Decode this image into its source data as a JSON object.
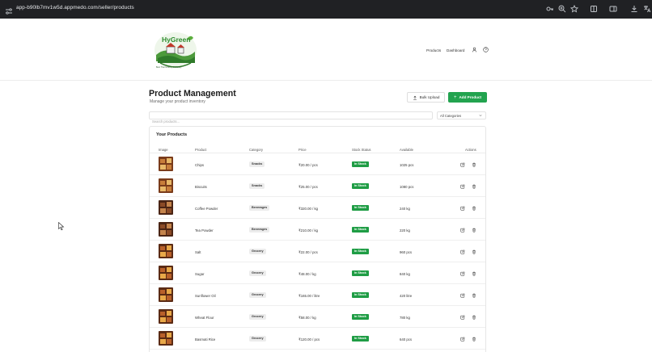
{
  "browser": {
    "url": "app-b90lb7mv1w5d.appmedo.com/seller/products",
    "icons": [
      "tune-icon",
      "key-icon",
      "zoom-icon",
      "star-icon",
      "extension-icon",
      "sidebar-icon",
      "download-icon",
      "translate-icon"
    ]
  },
  "header": {
    "logo_alt": "HyGreen",
    "logo_tagline": "Best Thai Grocery Of Family",
    "nav": {
      "products": "Products",
      "dashboard": "Dashboard"
    },
    "icons": [
      "user-icon",
      "help-icon"
    ]
  },
  "page": {
    "title": "Product Management",
    "subtitle": "Manage your product inventory",
    "bulk_upload": "Bulk Upload",
    "add_product": "Add Product"
  },
  "filters": {
    "search_placeholder": "Search products...",
    "search_value": "",
    "category_selected": "All Categories"
  },
  "products": {
    "title": "Your Products",
    "columns": {
      "image": "Image",
      "product": "Product",
      "category": "Category",
      "price": "Price",
      "stock": "Stock Status",
      "available": "Available",
      "actions": "Actions"
    },
    "rows": [
      {
        "name": "Chips",
        "category": "Snacks",
        "price": "₹20.00 / pcs",
        "stock": "In Stock",
        "available": "1025 pcs",
        "thumb": "snack"
      },
      {
        "name": "Biscuits",
        "category": "Snacks",
        "price": "₹25.00 / pcs",
        "stock": "In Stock",
        "available": "1080 pcs",
        "thumb": "snack"
      },
      {
        "name": "Coffee Powder",
        "category": "Beverages",
        "price": "₹320.00 / kg",
        "stock": "In Stock",
        "available": "240 kg",
        "thumb": "beverage"
      },
      {
        "name": "Tea Powder",
        "category": "Beverages",
        "price": "₹210.00 / kg",
        "stock": "In Stock",
        "available": "220 kg",
        "thumb": "beverage"
      },
      {
        "name": "Salt",
        "category": "Grocery",
        "price": "₹22.00 / pcs",
        "stock": "In Stock",
        "available": "960 pcs",
        "thumb": "grocery"
      },
      {
        "name": "Sugar",
        "category": "Grocery",
        "price": "₹48.00 / kg",
        "stock": "In Stock",
        "available": "840 kg",
        "thumb": "grocery"
      },
      {
        "name": "Sunflower Oil",
        "category": "Grocery",
        "price": "₹165.00 / litre",
        "stock": "In Stock",
        "available": "420 litre",
        "thumb": "grocery"
      },
      {
        "name": "Wheat Flour",
        "category": "Grocery",
        "price": "₹58.00 / kg",
        "stock": "In Stock",
        "available": "780 kg",
        "thumb": "grocery"
      },
      {
        "name": "Basmati Rice",
        "category": "Grocery",
        "price": "₹120.00 / pcs",
        "stock": "In Stock",
        "available": "640 pcs",
        "thumb": "grocery"
      }
    ]
  },
  "colors": {
    "primary_green": "#22a34f",
    "stock_green": "#1f9d45",
    "browser_bar": "#202124"
  }
}
